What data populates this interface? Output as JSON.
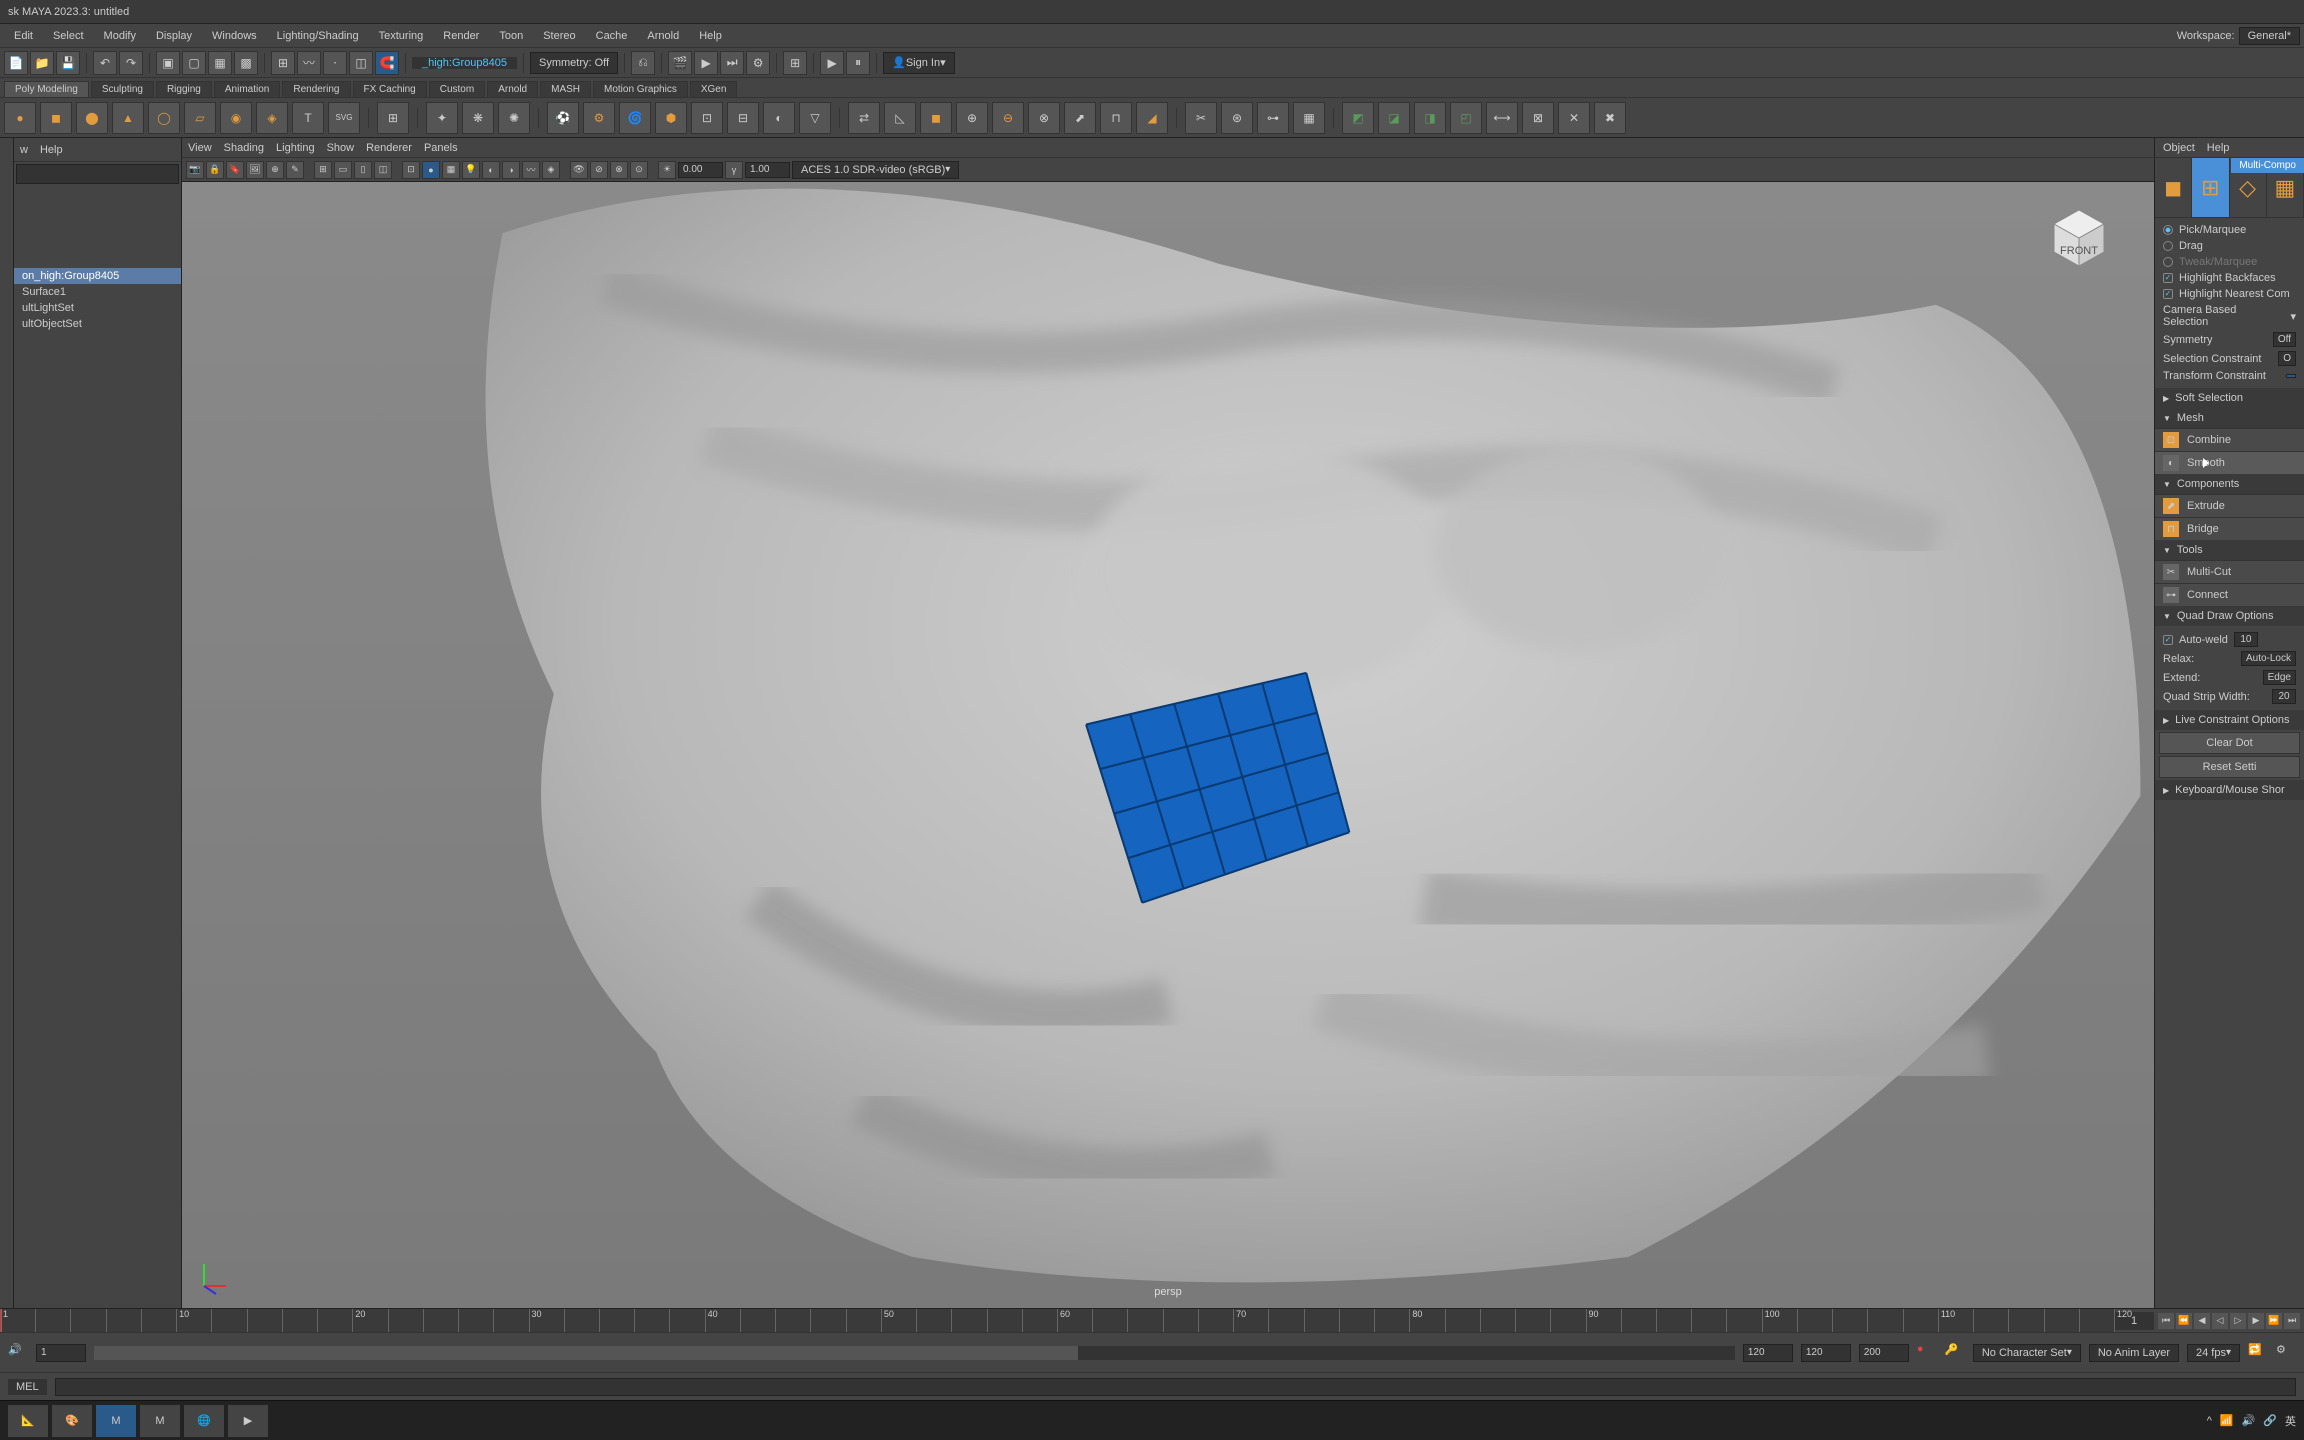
{
  "title": "sk MAYA 2023.3: untitled",
  "menubar": [
    "Edit",
    "Select",
    "Modify",
    "Display",
    "Windows",
    "Lighting/Shading",
    "Texturing",
    "Render",
    "Toon",
    "Stereo",
    "Cache",
    "Arnold",
    "Help"
  ],
  "workspace_label": "Workspace:",
  "workspace_value": "General*",
  "toolbar1": {
    "live_object": "_high:Group8405",
    "symmetry": "Symmetry: Off",
    "signin": "Sign In"
  },
  "shelftabs": [
    "Poly Modeling",
    "Sculpting",
    "Rigging",
    "Animation",
    "Rendering",
    "FX Caching",
    "Custom",
    "Arnold",
    "MASH",
    "Motion Graphics",
    "XGen"
  ],
  "outliner": {
    "menus": [
      "w",
      "Help"
    ],
    "items": [
      "on_high:Group8405",
      "Surface1",
      "ultLightSet",
      "ultObjectSet"
    ]
  },
  "panel_menus": [
    "View",
    "Shading",
    "Lighting",
    "Show",
    "Renderer",
    "Panels"
  ],
  "viewport": {
    "exposure": "0.00",
    "gamma": "1.00",
    "colorspace": "ACES 1.0 SDR-video (sRGB)",
    "camera": "persp"
  },
  "right_menu": [
    "Object",
    "Help"
  ],
  "right_panel": {
    "mode_title": "Multi-Compo",
    "pick": "Pick/Marquee",
    "drag": "Drag",
    "tweak": "Tweak/Marquee",
    "hl_back": "Highlight Backfaces",
    "hl_near": "Highlight Nearest Com",
    "cam_sel": "Camera Based Selection",
    "sym": "Symmetry",
    "sym_val": "Off",
    "sel_con": "Selection Constraint",
    "sel_con_val": "O",
    "trans_con": "Transform Constraint",
    "soft_sel": "Soft Selection",
    "mesh_hdr": "Mesh",
    "combine": "Combine",
    "smooth": "Smooth",
    "comp_hdr": "Components",
    "extrude": "Extrude",
    "bridge": "Bridge",
    "tools_hdr": "Tools",
    "multicut": "Multi-Cut",
    "connect": "Connect",
    "quad_hdr": "Quad Draw Options",
    "autoweld": "Auto-weld",
    "autoweld_val": "10",
    "relax": "Relax:",
    "relax_val": "Auto-Lock",
    "extend": "Extend:",
    "extend_val": "Edge",
    "qstrip": "Quad Strip Width:",
    "qstrip_val": "20",
    "live_con": "Live Constraint Options",
    "clear": "Clear Dot",
    "reset": "Reset Setti",
    "kbd": "Keyboard/Mouse Shor"
  },
  "timeline": {
    "current_frame": "1",
    "playback_start": "1",
    "playback_end": "120",
    "range_start": "120",
    "range_end": "200",
    "char_set": "No Character Set",
    "anim_layer": "No Anim Layer",
    "fps": "24 fps"
  },
  "cmdline_label": "MEL",
  "taskbar_lang": "英"
}
